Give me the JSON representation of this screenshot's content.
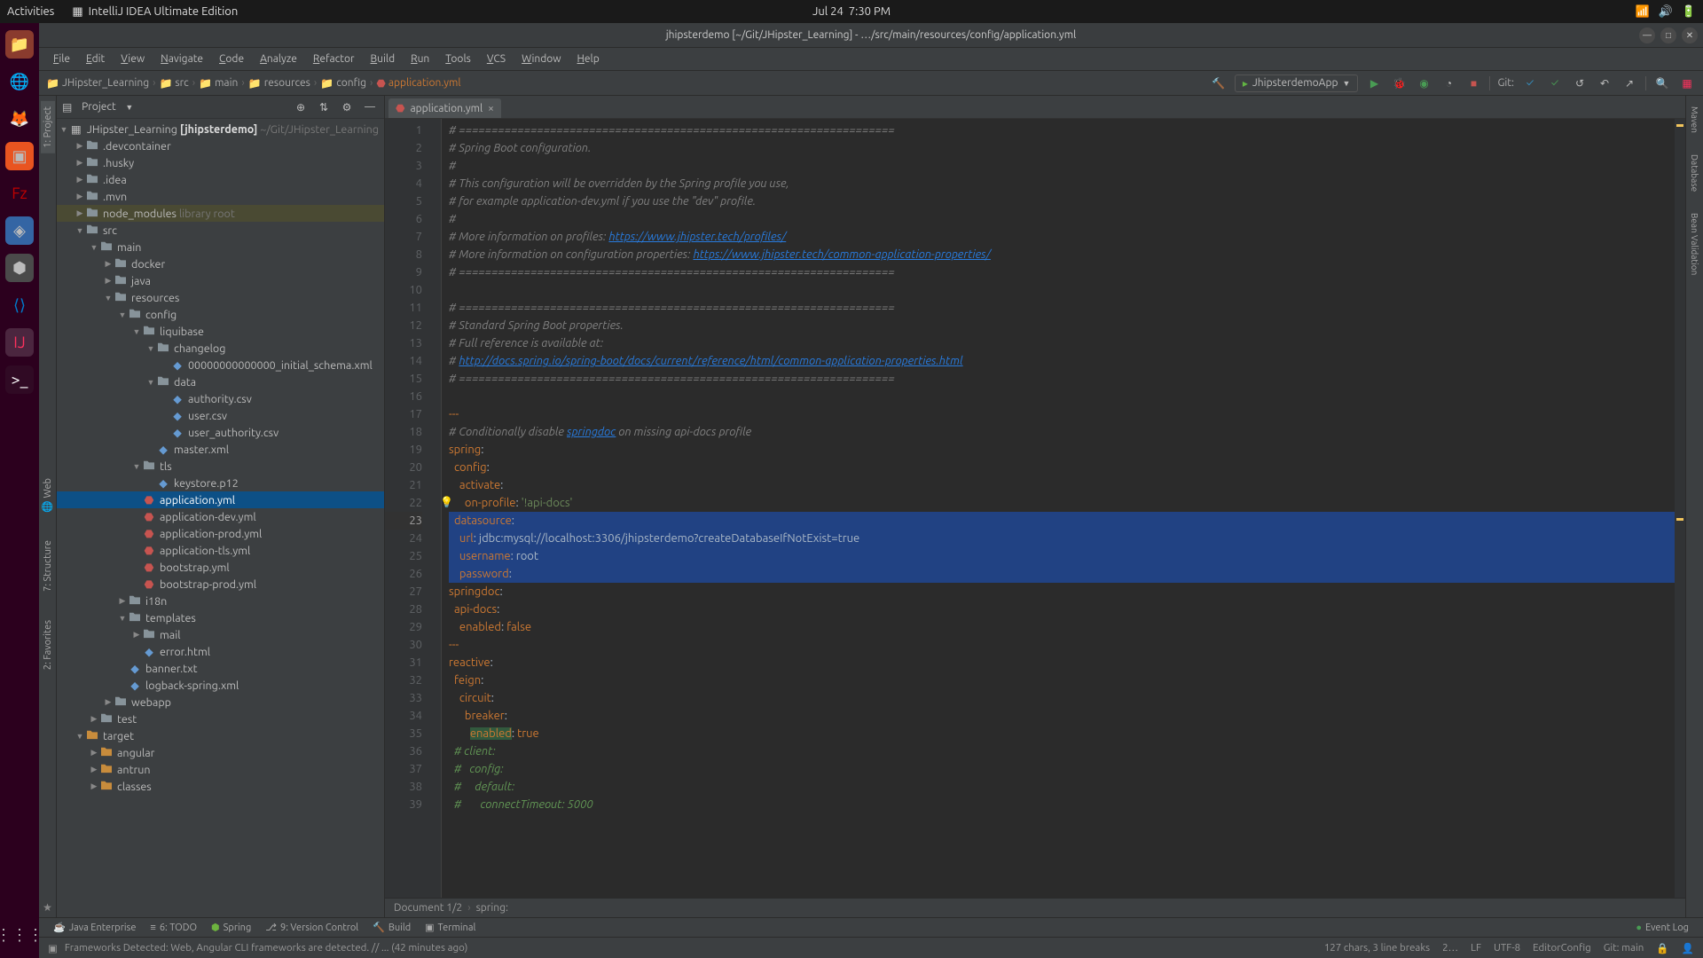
{
  "gnome": {
    "activities": "Activities",
    "app_name": "IntelliJ IDEA Ultimate Edition",
    "date": "Jul 24",
    "time": "7:30 PM"
  },
  "window": {
    "title": "jhipsterdemo [~/Git/JHipster_Learning] - …/src/main/resources/config/application.yml"
  },
  "menu": [
    "File",
    "Edit",
    "View",
    "Navigate",
    "Code",
    "Analyze",
    "Refactor",
    "Build",
    "Run",
    "Tools",
    "VCS",
    "Window",
    "Help"
  ],
  "breadcrumb": {
    "items": [
      "JHipster_Learning",
      "src",
      "main",
      "resources",
      "config",
      "application.yml"
    ]
  },
  "run_config": "JhipsterdemoApp",
  "git_label": "Git:",
  "project": {
    "title": "Project",
    "root_name": "JHipster_Learning",
    "root_bold": "[jhipsterdemo]",
    "root_path": "~/Git/JHipster_Learning",
    "tree": [
      {
        "d": 1,
        "t": "dir",
        "l": ".devcontainer",
        "exp": false
      },
      {
        "d": 1,
        "t": "dir",
        "l": ".husky",
        "exp": false
      },
      {
        "d": 1,
        "t": "dir",
        "l": ".idea",
        "exp": false,
        "cls": "ex"
      },
      {
        "d": 1,
        "t": "dir",
        "l": ".mvn",
        "exp": false
      },
      {
        "d": 1,
        "t": "dir",
        "l": "node_modules",
        "suffix": "library root",
        "exp": false,
        "hl": true,
        "cls": "orange-t"
      },
      {
        "d": 1,
        "t": "dir",
        "l": "src",
        "exp": true
      },
      {
        "d": 2,
        "t": "dir",
        "l": "main",
        "exp": true
      },
      {
        "d": 3,
        "t": "dir",
        "l": "docker",
        "exp": false
      },
      {
        "d": 3,
        "t": "dir",
        "l": "java",
        "exp": false
      },
      {
        "d": 3,
        "t": "dir",
        "l": "resources",
        "exp": true
      },
      {
        "d": 4,
        "t": "dir",
        "l": "config",
        "exp": true
      },
      {
        "d": 5,
        "t": "dir",
        "l": "liquibase",
        "exp": true
      },
      {
        "d": 6,
        "t": "dir",
        "l": "changelog",
        "exp": true
      },
      {
        "d": 7,
        "t": "file",
        "l": "00000000000000_initial_schema.xml",
        "ic": "leaf"
      },
      {
        "d": 6,
        "t": "dir",
        "l": "data",
        "exp": true
      },
      {
        "d": 7,
        "t": "file",
        "l": "authority.csv",
        "ic": "leaf"
      },
      {
        "d": 7,
        "t": "file",
        "l": "user.csv",
        "ic": "leaf"
      },
      {
        "d": 7,
        "t": "file",
        "l": "user_authority.csv",
        "ic": "leaf"
      },
      {
        "d": 6,
        "t": "file",
        "l": "master.xml",
        "ic": "leaf"
      },
      {
        "d": 5,
        "t": "dir",
        "l": "tls",
        "exp": true
      },
      {
        "d": 6,
        "t": "file",
        "l": "keystore.p12",
        "ic": "leaf"
      },
      {
        "d": 5,
        "t": "file",
        "l": "application.yml",
        "ic": "yml",
        "sel": true
      },
      {
        "d": 5,
        "t": "file",
        "l": "application-dev.yml",
        "ic": "yml"
      },
      {
        "d": 5,
        "t": "file",
        "l": "application-prod.yml",
        "ic": "yml"
      },
      {
        "d": 5,
        "t": "file",
        "l": "application-tls.yml",
        "ic": "yml"
      },
      {
        "d": 5,
        "t": "file",
        "l": "bootstrap.yml",
        "ic": "yml"
      },
      {
        "d": 5,
        "t": "file",
        "l": "bootstrap-prod.yml",
        "ic": "yml"
      },
      {
        "d": 4,
        "t": "dir",
        "l": "i18n",
        "exp": false
      },
      {
        "d": 4,
        "t": "dir",
        "l": "templates",
        "exp": true
      },
      {
        "d": 5,
        "t": "dir",
        "l": "mail",
        "exp": false
      },
      {
        "d": 5,
        "t": "file",
        "l": "error.html",
        "ic": "leaf"
      },
      {
        "d": 4,
        "t": "file",
        "l": "banner.txt",
        "ic": "leaf"
      },
      {
        "d": 4,
        "t": "file",
        "l": "logback-spring.xml",
        "ic": "leaf"
      },
      {
        "d": 3,
        "t": "dir",
        "l": "webapp",
        "exp": false
      },
      {
        "d": 2,
        "t": "dir",
        "l": "test",
        "exp": false
      },
      {
        "d": 1,
        "t": "dir",
        "l": "target",
        "exp": true,
        "cls": "orange-t",
        "of": true
      },
      {
        "d": 2,
        "t": "dir",
        "l": "angular",
        "exp": false,
        "cls": "orange-t",
        "of": true
      },
      {
        "d": 2,
        "t": "dir",
        "l": "antrun",
        "exp": false,
        "cls": "orange-t",
        "of": true
      },
      {
        "d": 2,
        "t": "dir",
        "l": "classes",
        "exp": false,
        "cls": "orange-t",
        "of": true
      }
    ]
  },
  "editor": {
    "tab": "application.yml",
    "lines": [
      {
        "n": 1,
        "h": "<span class='cmt'># ===================================================================</span>"
      },
      {
        "n": 2,
        "h": "<span class='cmt'># Spring Boot configuration.</span>"
      },
      {
        "n": 3,
        "h": "<span class='cmt'>#</span>"
      },
      {
        "n": 4,
        "h": "<span class='cmt'># This configuration will be overridden by the Spring profile you use,</span>"
      },
      {
        "n": 5,
        "h": "<span class='cmt'># for example application-dev.yml if you use the \"dev\" profile.</span>"
      },
      {
        "n": 6,
        "h": "<span class='cmt'>#</span>"
      },
      {
        "n": 7,
        "h": "<span class='cmt'># More information on profiles: </span><span class='link'>https://www.jhipster.tech/profiles/</span>"
      },
      {
        "n": 8,
        "h": "<span class='cmt'># More information on configuration properties: </span><span class='link'>https://www.jhipster.tech/common-application-properties/</span>"
      },
      {
        "n": 9,
        "h": "<span class='cmt'># ===================================================================</span>"
      },
      {
        "n": 10,
        "h": ""
      },
      {
        "n": 11,
        "h": "<span class='cmt'># ===================================================================</span>"
      },
      {
        "n": 12,
        "h": "<span class='cmt'># Standard Spring Boot properties.</span>"
      },
      {
        "n": 13,
        "h": "<span class='cmt'># Full reference is available at:</span>"
      },
      {
        "n": 14,
        "h": "<span class='cmt'># </span><span class='link'>http://docs.spring.io/spring-boot/docs/current/reference/html/common-application-properties.html</span>"
      },
      {
        "n": 15,
        "h": "<span class='cmt'># ===================================================================</span>"
      },
      {
        "n": 16,
        "h": ""
      },
      {
        "n": 17,
        "h": "<span class='key'>---</span>"
      },
      {
        "n": 18,
        "h": "<span class='cmt'># Conditionally disable </span><span class='link'>springdoc</span><span class='cmt'> on missing api-docs profile</span>"
      },
      {
        "n": 19,
        "h": "<span class='key'>spring</span>:"
      },
      {
        "n": 20,
        "h": "  <span class='key'>config</span>:"
      },
      {
        "n": 21,
        "h": "    <span class='key'>activate</span>:"
      },
      {
        "n": 22,
        "h": "      <span class='key'>on-profile</span>: <span class='str'>'!api-docs'</span>",
        "bulb": true
      },
      {
        "n": 23,
        "h": "  <span class='key'>datasource</span>:<span class='sel'> </span>",
        "cur": true,
        "selline": true
      },
      {
        "n": 24,
        "h": "    <span class='key'>url</span>: <span class='val'>jdbc:mysql://localhost:3306/jhipsterdemo?createDatabaseIfNotExist=true</span>",
        "selline": true
      },
      {
        "n": 25,
        "h": "    <span class='key'>username</span>: <span class='val'>root</span>",
        "selline": true
      },
      {
        "n": 26,
        "h": "    <span class='key'>password</span>:<span class='sel'> </span>",
        "selline": true
      },
      {
        "n": 27,
        "h": "<span class='key'>springdoc</span>:"
      },
      {
        "n": 28,
        "h": "  <span class='key'>api-docs</span>:"
      },
      {
        "n": 29,
        "h": "    <span class='key'>enabled</span>: <span class='key'>false</span>"
      },
      {
        "n": 30,
        "h": "<span class='key'>---</span>"
      },
      {
        "n": 31,
        "h": "<span class='key'>reactive</span>:"
      },
      {
        "n": 32,
        "h": "  <span class='key'>feign</span>:"
      },
      {
        "n": 33,
        "h": "    <span class='key'>circuit</span>:"
      },
      {
        "n": 34,
        "h": "      <span class='key'>breaker</span>:"
      },
      {
        "n": 35,
        "h": "        <span class='hl key'>enabled</span>: <span class='key'>true</span>"
      },
      {
        "n": 36,
        "h": "  <span class='cmt2'># client:</span>"
      },
      {
        "n": 37,
        "h": "  <span class='cmt2'>#   config:</span>"
      },
      {
        "n": 38,
        "h": "  <span class='cmt2'>#     default:</span>"
      },
      {
        "n": 39,
        "h": "  <span class='cmt2'>#       connectTimeout: 5000</span>"
      }
    ],
    "crumb1": "Document 1/2",
    "crumb2": "spring:"
  },
  "right_tools": [
    "Maven",
    "Database",
    "Bean Validation"
  ],
  "left_tools": {
    "project": "1: Project",
    "web": "Web",
    "structure": "7: Structure",
    "favorites": "2: Favorites"
  },
  "bottom_tools": {
    "java_ent": "Java Enterprise",
    "todo": "6: TODO",
    "spring": "Spring",
    "vcs": "9: Version Control",
    "build": "Build",
    "terminal": "Terminal",
    "eventlog": "Event Log"
  },
  "status": {
    "msg": "Frameworks Detected: Web, Angular CLI frameworks are detected. // ... (42 minutes ago)",
    "chars": "127 chars, 3 line breaks",
    "pos": "2…",
    "lf": "LF",
    "enc": "UTF-8",
    "econf": "EditorConfig",
    "git": "Git: main"
  }
}
